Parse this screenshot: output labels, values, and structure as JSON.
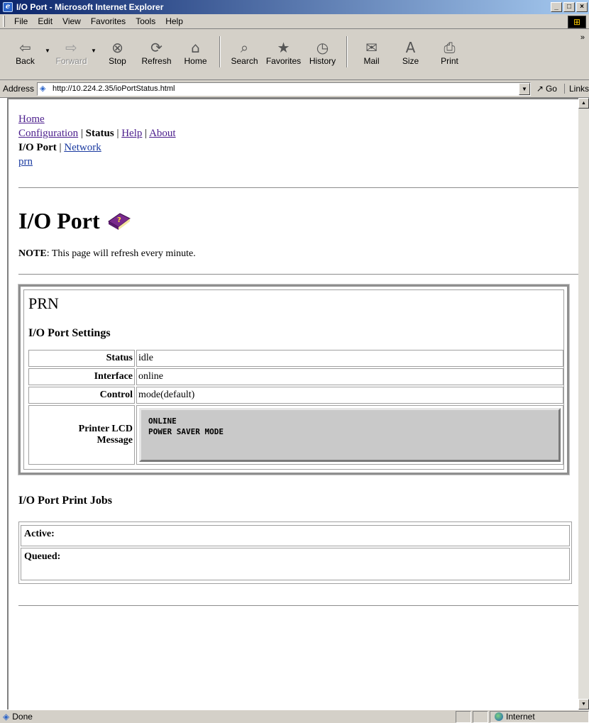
{
  "window": {
    "title": "I/O Port - Microsoft Internet Explorer",
    "controls": [
      "_",
      "□",
      "×"
    ]
  },
  "menu": [
    "File",
    "Edit",
    "View",
    "Favorites",
    "Tools",
    "Help"
  ],
  "toolbar": {
    "back": "Back",
    "forward": "Forward",
    "stop": "Stop",
    "refresh": "Refresh",
    "home": "Home",
    "search": "Search",
    "favorites": "Favorites",
    "history": "History",
    "mail": "Mail",
    "size": "Size",
    "print": "Print"
  },
  "address": {
    "label": "Address",
    "url": "http://10.224.2.35/ioPortStatus.html",
    "go": "Go",
    "links": "Links"
  },
  "nav": {
    "home": "Home",
    "configuration": "Configuration",
    "status": "Status",
    "help": "Help",
    "about": "About",
    "io_port": "I/O Port",
    "network": "Network",
    "prn": "prn",
    "sep": "|"
  },
  "page": {
    "heading": "I/O Port",
    "note_label": "NOTE",
    "note_text": ": This page will refresh every minute."
  },
  "port": {
    "name": "PRN",
    "settings_heading": "I/O Port Settings",
    "status_label": "Status",
    "status_value": "idle",
    "interface_label": "Interface",
    "interface_value": "online",
    "control_label": "Control",
    "control_value": "mode(default)",
    "lcd_label_1": "Printer LCD",
    "lcd_label_2": "Message",
    "lcd_line_1": "ONLINE",
    "lcd_line_2": "POWER SAVER MODE"
  },
  "jobs": {
    "heading": "I/O Port Print Jobs",
    "active_label": "Active:",
    "queued_label": "Queued:"
  },
  "statusbar": {
    "text": "Done",
    "zone": "Internet"
  }
}
